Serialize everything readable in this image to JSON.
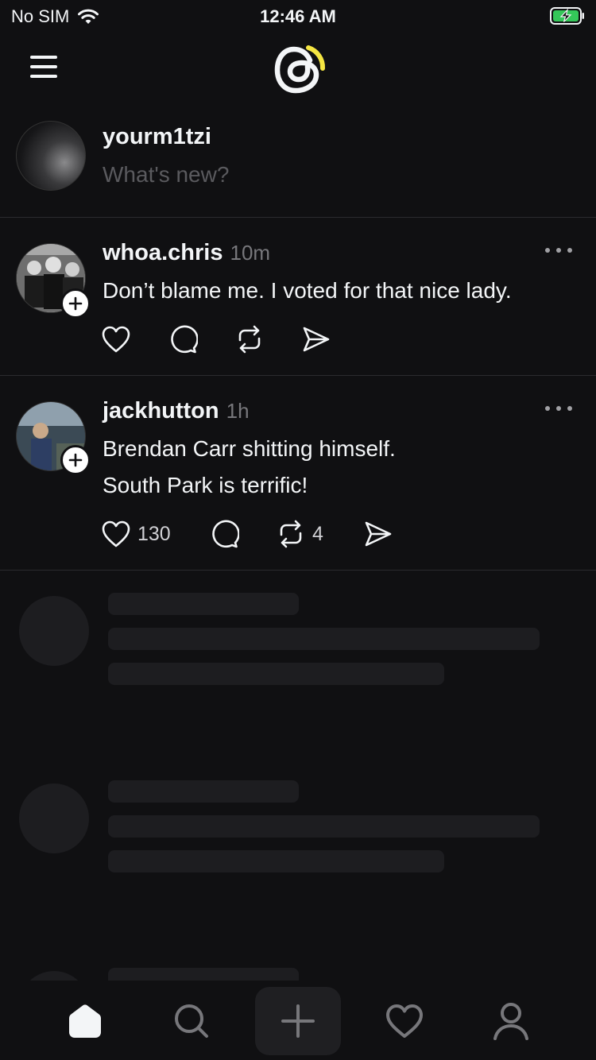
{
  "status_bar": {
    "carrier": "No SIM",
    "time": "12:46 AM",
    "battery_color": "#34c759"
  },
  "composer": {
    "username": "yourm1tzi",
    "placeholder": "What's new?"
  },
  "posts": [
    {
      "username": "whoa.chris",
      "time": "10m",
      "lines": [
        "Don’t blame me. I voted for that nice lady."
      ],
      "likes": "",
      "reposts": ""
    },
    {
      "username": "jackhutton",
      "time": "1h",
      "lines": [
        "Brendan Carr shitting himself.",
        "South Park is terrific!"
      ],
      "likes": "130",
      "reposts": "4"
    }
  ],
  "skeleton_count": 3,
  "tabs": [
    "home-icon",
    "search-icon",
    "compose-icon",
    "activity-icon",
    "profile-icon"
  ],
  "colors": {
    "background": "#101012",
    "text": "#f3f5f7",
    "muted": "#77777b",
    "logo_accent": "#f5e642"
  }
}
